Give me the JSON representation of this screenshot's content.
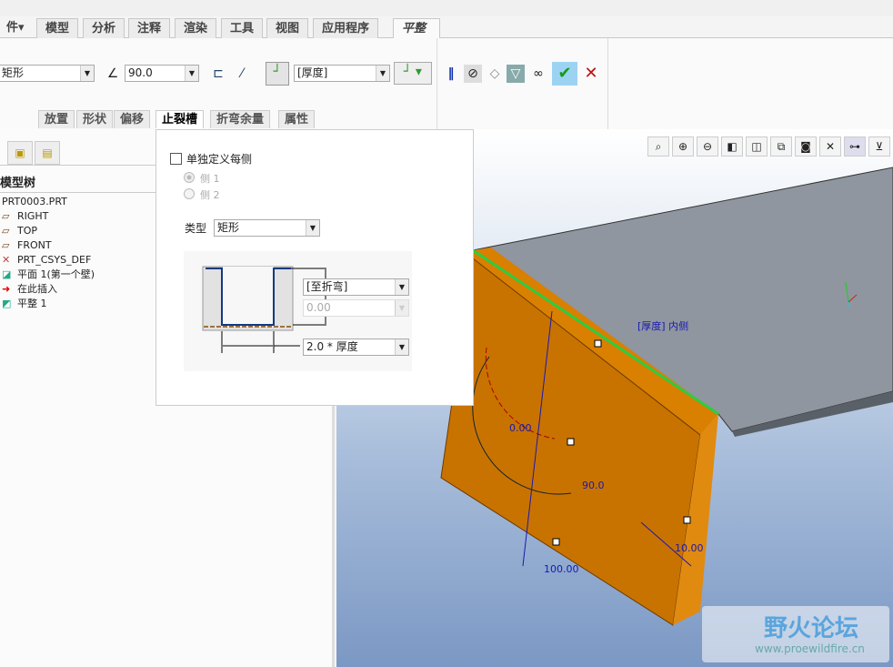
{
  "tabs": {
    "file": "件▾",
    "items": [
      "模型",
      "分析",
      "注释",
      "渲染",
      "工具",
      "视图",
      "应用程序"
    ],
    "active": "平整"
  },
  "ribbon": {
    "shape_value": "矩形",
    "angle_value": "90.0",
    "thickness_value": "[厚度]"
  },
  "subtabs": [
    "放置",
    "形状",
    "偏移",
    "止裂槽",
    "折弯余量",
    "属性"
  ],
  "model_tree": {
    "title": "模型树",
    "items": [
      "PRT0003.PRT",
      "RIGHT",
      "TOP",
      "FRONT",
      "PRT_CSYS_DEF",
      "平面 1(第一个壁)",
      "在此插入",
      "平整 1"
    ]
  },
  "relief": {
    "checkbox_label": "单独定义每侧",
    "side1": "侧 1",
    "side2": "侧 2",
    "type_label": "类型",
    "type_value": "矩形",
    "depth_value": "[至折弯]",
    "depth_num": "0.00",
    "width_value": "2.0 * 厚度"
  },
  "dims": {
    "d1": "0.00",
    "d2": "90.0",
    "d3": "100.00",
    "d4": "10.00",
    "label": "[厚度] 内侧"
  },
  "watermark": {
    "brand": "野火论坛",
    "url": "www.proewildfire.cn"
  }
}
